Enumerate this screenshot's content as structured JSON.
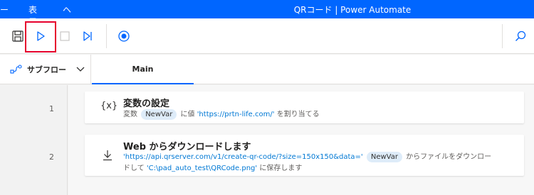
{
  "window": {
    "menu_items": [
      "ール",
      "表示",
      "ヘルプ"
    ],
    "title": "QRコード | Power Automate"
  },
  "toolbar": {
    "buttons": [
      {
        "name": "save-icon"
      },
      {
        "name": "run-icon"
      },
      {
        "name": "stop-icon"
      },
      {
        "name": "step-icon"
      },
      {
        "name": "record-icon"
      },
      {
        "name": "search-icon"
      }
    ]
  },
  "tabs": {
    "subflow_label": "サブフロー",
    "main_label": "Main"
  },
  "actions": [
    {
      "line": "1",
      "icon": "{x}",
      "title": "変数の設定",
      "desc_prefix": "変数",
      "var_chip": "NewVar",
      "desc_mid": "に値",
      "value": "'https://prtn-life.com/'",
      "desc_suffix": "を割り当てる"
    },
    {
      "line": "2",
      "icon": "download-icon",
      "title": "Web からダウンロードします",
      "url": "'https://api.qrserver.com/v1/create-qr-code/?size=150x150&data='",
      "var_chip": "NewVar",
      "desc_after_chip": "からファイルをダウンロー",
      "desc_line2_prefix": "ドして",
      "path": "'C:\\pad_auto_test\\QRCode.png'",
      "desc_line2_suffix": "に保存します"
    }
  ],
  "colors": {
    "accent": "#0066ff",
    "highlight": "#e6002d",
    "link": "#0078d4",
    "chip": "#deecf9"
  }
}
